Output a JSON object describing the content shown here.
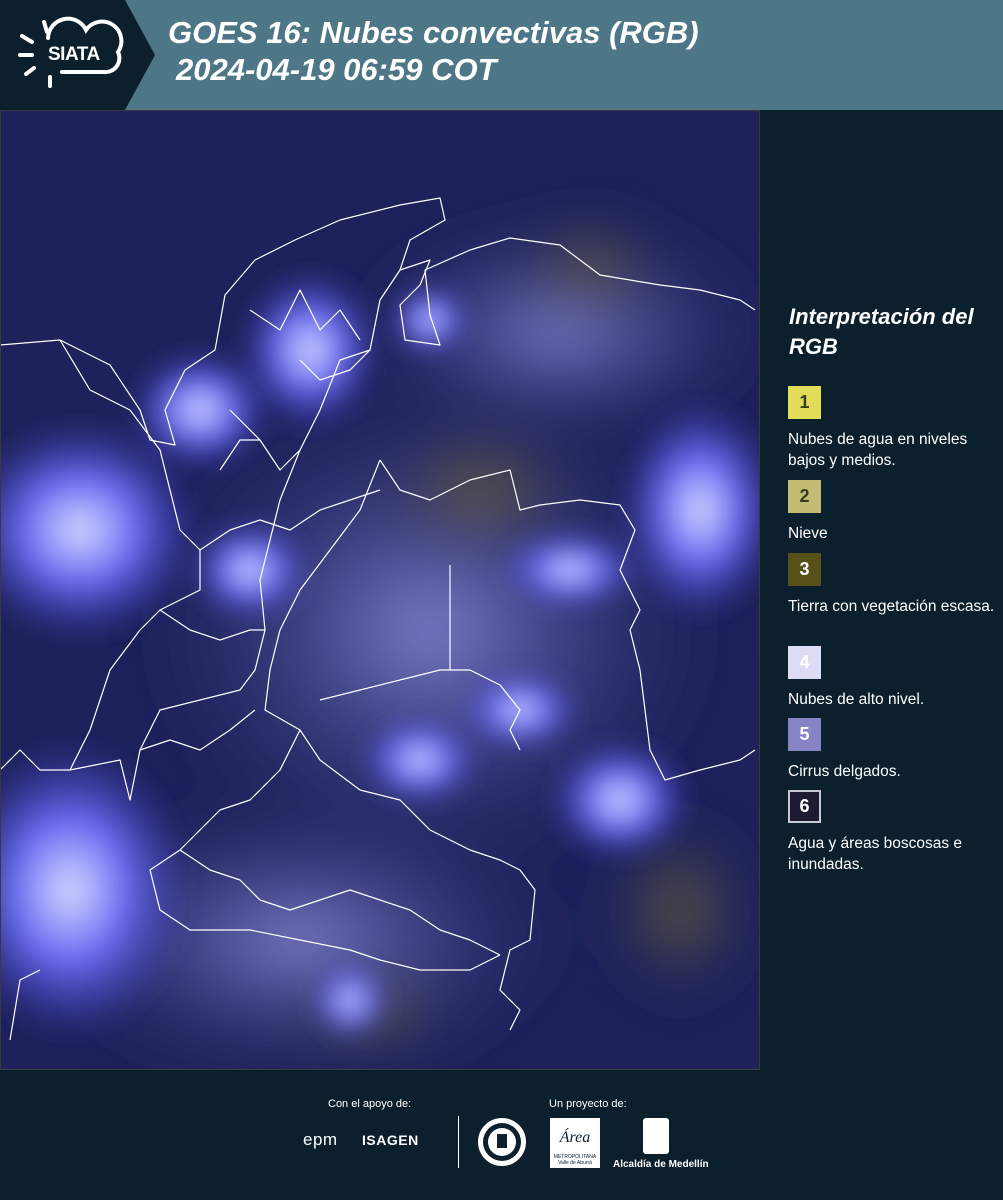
{
  "header": {
    "logo_text": "SIATA",
    "title_line1": "GOES 16: Nubes convectivas (RGB)",
    "title_line2": "2024-04-19 06:59 COT"
  },
  "legend": {
    "title": "Interpretación del RGB",
    "items": [
      {
        "number": "1",
        "label": "Nubes de agua en niveles bajos y medios.",
        "color": "#e3dc57"
      },
      {
        "number": "2",
        "label": "Nieve",
        "color": "#c4bb75"
      },
      {
        "number": "3",
        "label": "Tierra con vegetación escasa.",
        "color": "#555118"
      },
      {
        "number": "4",
        "label": "Nubes de alto nivel.",
        "color": "#dcdcf7"
      },
      {
        "number": "5",
        "label": "Cirrus delgados.",
        "color": "#8784c6"
      },
      {
        "number": "6",
        "label": "Agua y áreas boscosas e inundadas.",
        "color": "#1e1a32"
      }
    ]
  },
  "footer": {
    "support_label": "Con el apoyo de:",
    "project_label": "Un proyecto de:",
    "epm": "epm",
    "isagen": "ISAGEN",
    "area_logo": "Área",
    "area_sub": "METROPOLITANA Valle de Aburrá",
    "alcaldia": "Alcaldía de Medellín"
  },
  "colors": {
    "header_bg": "#4d7686",
    "panel_bg": "#0b1f2c",
    "map_base": "#1b1e55",
    "cloud_blue": "#5a5cf0",
    "border_line": "#ffffff"
  }
}
